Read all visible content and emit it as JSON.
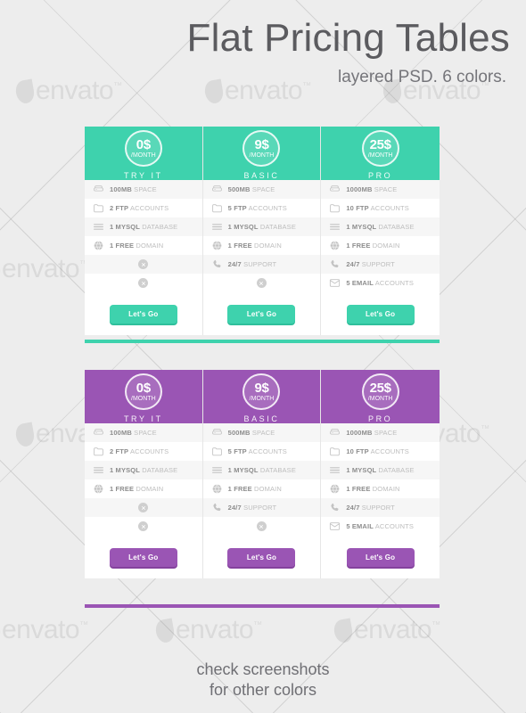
{
  "header": {
    "title": "Flat Pricing Tables",
    "subtitle": "layered PSD. 6 colors."
  },
  "footer": {
    "line1": "check screenshots",
    "line2": "for other colors"
  },
  "watermark": {
    "brand": "envato",
    "tm": "™"
  },
  "icons": {
    "space": "hard-drive-icon",
    "ftp": "folder-icon",
    "mysql": "database-lines-icon",
    "domain": "globe-icon",
    "support": "phone-icon",
    "email": "envelope-icon",
    "disabled": "x-circle-icon"
  },
  "colors": {
    "teal": "#3ED2AD",
    "teal_shadow": "#2FBF9B",
    "purple": "#9A55B4",
    "purple_shadow": "#84429D",
    "page_bg": "#EDEDED",
    "row_alt": "#F6F6F6",
    "text_strong": "#8D8D8D",
    "text_muted": "#BDBDBD"
  },
  "tables": [
    {
      "id": "teal-table",
      "theme": "teal",
      "columns": [
        {
          "plan": "TRY IT",
          "price_amount": "0$",
          "price_period": "/MONTH",
          "cta": "Let's Go",
          "features": [
            {
              "icon": "hard-drive-icon",
              "strong": "100MB",
              "muted": "SPACE",
              "enabled": true
            },
            {
              "icon": "folder-icon",
              "strong": "2 FTP",
              "muted": "ACCOUNTS",
              "enabled": true
            },
            {
              "icon": "database-lines-icon",
              "strong": "1 MYSQL",
              "muted": "DATABASE",
              "enabled": true
            },
            {
              "icon": "globe-icon",
              "strong": "1 FREE",
              "muted": "DOMAIN",
              "enabled": true
            },
            {
              "icon": "x-circle-icon",
              "strong": "",
              "muted": "",
              "enabled": false
            },
            {
              "icon": "x-circle-icon",
              "strong": "",
              "muted": "",
              "enabled": false
            }
          ]
        },
        {
          "plan": "BASIC",
          "price_amount": "9$",
          "price_period": "/MONTH",
          "cta": "Let's Go",
          "features": [
            {
              "icon": "hard-drive-icon",
              "strong": "500MB",
              "muted": "SPACE",
              "enabled": true
            },
            {
              "icon": "folder-icon",
              "strong": "5 FTP",
              "muted": "ACCOUNTS",
              "enabled": true
            },
            {
              "icon": "database-lines-icon",
              "strong": "1 MYSQL",
              "muted": "DATABASE",
              "enabled": true
            },
            {
              "icon": "globe-icon",
              "strong": "1 FREE",
              "muted": "DOMAIN",
              "enabled": true
            },
            {
              "icon": "phone-icon",
              "strong": "24/7",
              "muted": "SUPPORT",
              "enabled": true
            },
            {
              "icon": "x-circle-icon",
              "strong": "",
              "muted": "",
              "enabled": false
            }
          ]
        },
        {
          "plan": "PRO",
          "price_amount": "25$",
          "price_period": "/MONTH",
          "cta": "Let's Go",
          "features": [
            {
              "icon": "hard-drive-icon",
              "strong": "1000MB",
              "muted": "SPACE",
              "enabled": true
            },
            {
              "icon": "folder-icon",
              "strong": "10 FTP",
              "muted": "ACCOUNTS",
              "enabled": true
            },
            {
              "icon": "database-lines-icon",
              "strong": "1 MYSQL",
              "muted": "DATABASE",
              "enabled": true
            },
            {
              "icon": "globe-icon",
              "strong": "1 FREE",
              "muted": "DOMAIN",
              "enabled": true
            },
            {
              "icon": "phone-icon",
              "strong": "24/7",
              "muted": "SUPPORT",
              "enabled": true
            },
            {
              "icon": "envelope-icon",
              "strong": "5 EMAIL",
              "muted": "ACCOUNTS",
              "enabled": true
            }
          ]
        }
      ]
    },
    {
      "id": "purple-table",
      "theme": "purple",
      "columns": [
        {
          "plan": "TRY IT",
          "price_amount": "0$",
          "price_period": "/MONTH",
          "cta": "Let's Go",
          "features": [
            {
              "icon": "hard-drive-icon",
              "strong": "100MB",
              "muted": "SPACE",
              "enabled": true
            },
            {
              "icon": "folder-icon",
              "strong": "2 FTP",
              "muted": "ACCOUNTS",
              "enabled": true
            },
            {
              "icon": "database-lines-icon",
              "strong": "1 MYSQL",
              "muted": "DATABASE",
              "enabled": true
            },
            {
              "icon": "globe-icon",
              "strong": "1 FREE",
              "muted": "DOMAIN",
              "enabled": true
            },
            {
              "icon": "x-circle-icon",
              "strong": "",
              "muted": "",
              "enabled": false
            },
            {
              "icon": "x-circle-icon",
              "strong": "",
              "muted": "",
              "enabled": false
            }
          ]
        },
        {
          "plan": "BASIC",
          "price_amount": "9$",
          "price_period": "/MONTH",
          "cta": "Let's Go",
          "features": [
            {
              "icon": "hard-drive-icon",
              "strong": "500MB",
              "muted": "SPACE",
              "enabled": true
            },
            {
              "icon": "folder-icon",
              "strong": "5 FTP",
              "muted": "ACCOUNTS",
              "enabled": true
            },
            {
              "icon": "database-lines-icon",
              "strong": "1 MYSQL",
              "muted": "DATABASE",
              "enabled": true
            },
            {
              "icon": "globe-icon",
              "strong": "1 FREE",
              "muted": "DOMAIN",
              "enabled": true
            },
            {
              "icon": "phone-icon",
              "strong": "24/7",
              "muted": "SUPPORT",
              "enabled": true
            },
            {
              "icon": "x-circle-icon",
              "strong": "",
              "muted": "",
              "enabled": false
            }
          ]
        },
        {
          "plan": "PRO",
          "price_amount": "25$",
          "price_period": "/MONTH",
          "cta": "Let's Go",
          "features": [
            {
              "icon": "hard-drive-icon",
              "strong": "1000MB",
              "muted": "SPACE",
              "enabled": true
            },
            {
              "icon": "folder-icon",
              "strong": "10 FTP",
              "muted": "ACCOUNTS",
              "enabled": true
            },
            {
              "icon": "database-lines-icon",
              "strong": "1 MYSQL",
              "muted": "DATABASE",
              "enabled": true
            },
            {
              "icon": "globe-icon",
              "strong": "1 FREE",
              "muted": "DOMAIN",
              "enabled": true
            },
            {
              "icon": "phone-icon",
              "strong": "24/7",
              "muted": "SUPPORT",
              "enabled": true
            },
            {
              "icon": "envelope-icon",
              "strong": "5 EMAIL",
              "muted": "ACCOUNTS",
              "enabled": true
            }
          ]
        }
      ]
    }
  ]
}
